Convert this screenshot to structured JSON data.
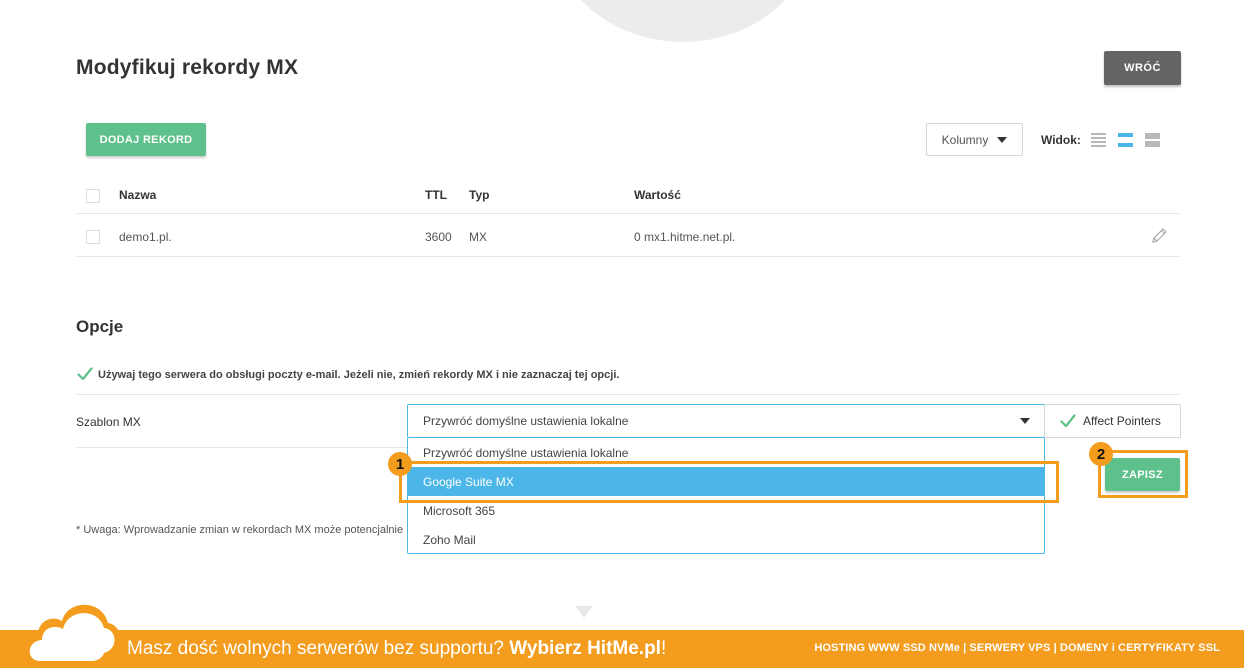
{
  "header": {
    "title": "Modyfikuj rekordy MX",
    "back_label": "WRÓĆ"
  },
  "toolbar": {
    "add_label": "DODAJ REKORD",
    "columns_label": "Kolumny",
    "view_label": "Widok:",
    "view_icons": [
      "compact-list-icon",
      "normal-list-icon",
      "large-list-icon"
    ],
    "active_view": 1
  },
  "table": {
    "headers": {
      "name": "Nazwa",
      "ttl": "TTL",
      "type": "Typ",
      "value": "Wartość"
    },
    "rows": [
      {
        "name": "demo1.pl.",
        "ttl": "3600",
        "type": "MX",
        "value": "0 mx1.hitme.net.pl."
      }
    ]
  },
  "options": {
    "title": "Opcje",
    "use_server_label": "Używaj tego serwera do obsługi poczty e-mail. Jeżeli nie, zmień rekordy MX i nie zaznaczaj tej opcji.",
    "use_server_checked": true,
    "template_label": "Szablon MX",
    "template_selected": "Przywróć domyślne ustawienia lokalne",
    "template_options": [
      "Przywróć domyślne ustawienia lokalne",
      "Google Suite MX",
      "Microsoft 365",
      "Zoho Mail"
    ],
    "highlighted_option": 1,
    "affect_pointers_label": "Affect Pointers",
    "affect_pointers_checked": true,
    "save_label": "ZAPISZ",
    "note": "* Uwaga: Wprowadzanie zmian w rekordach MX może potencjalnie"
  },
  "annotations": {
    "badge1": "1",
    "badge2": "2",
    "color": "#f39c1d"
  },
  "banner": {
    "text_light": "Masz dość wolnych serwerów bez supportu? ",
    "text_bold": "Wybierz HitMe.pl",
    "text_end": "!",
    "right_text": "HOSTING WWW SSD NVMe | SERWERY VPS | DOMENY i CERTYFIKATY SSL"
  },
  "colors": {
    "green": "#5ec08a",
    "blue": "#4db6e8",
    "orange": "#f39c1d",
    "gray_button": "#646464"
  }
}
